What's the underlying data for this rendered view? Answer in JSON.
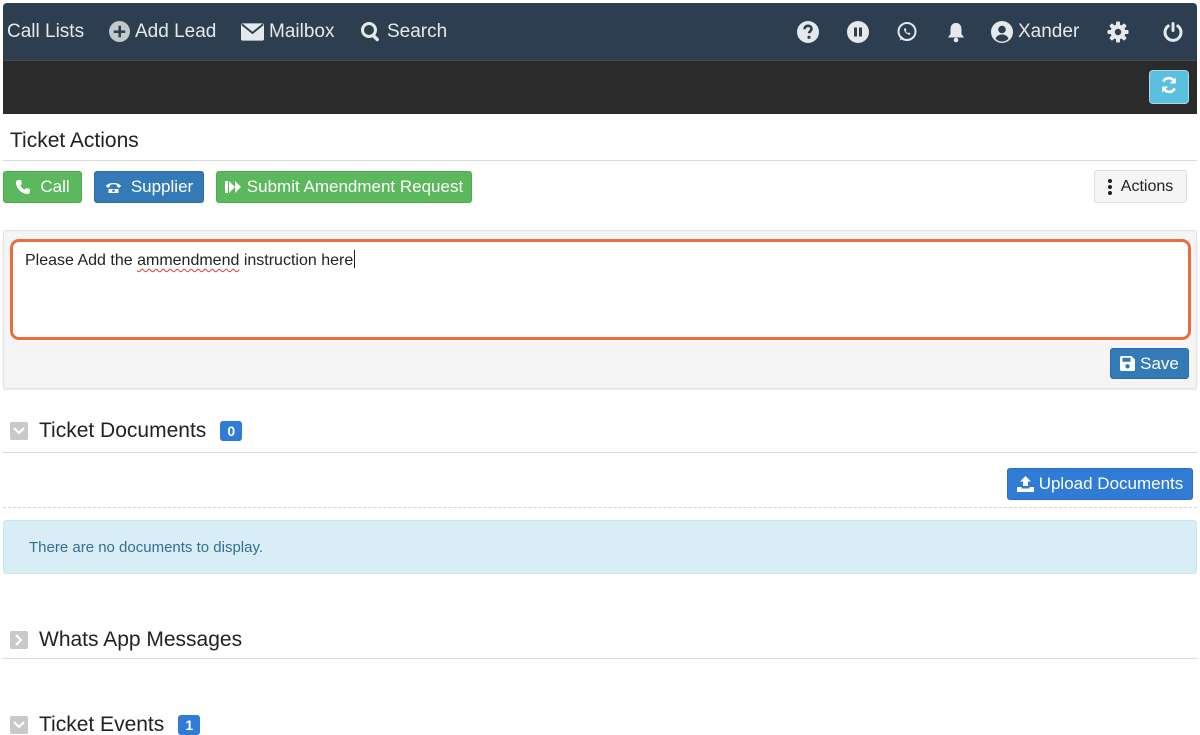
{
  "nav": {
    "call_lists": "Call Lists",
    "add_lead": "Add Lead",
    "mailbox": "Mailbox",
    "search": "Search",
    "user": "Xander"
  },
  "icons": {
    "add_lead": "plus-circle-icon",
    "mailbox": "envelope-icon",
    "search": "search-icon",
    "help": "question-circle-icon",
    "pause": "pause-circle-icon",
    "whatsapp": "whatsapp-icon",
    "notifications": "bell-icon",
    "user": "user-circle-icon",
    "settings": "gear-icon",
    "power": "power-icon",
    "refresh": "refresh-icon"
  },
  "ticket_actions": {
    "title": "Ticket Actions",
    "call_label": "Call",
    "supplier_label": "Supplier",
    "submit_label": "Submit Amendment Request",
    "actions_label": "Actions"
  },
  "amendment": {
    "text_before": "Please Add the ",
    "misspelled": "ammendmend",
    "text_after": " instruction here",
    "save_label": "Save"
  },
  "documents": {
    "title": "Ticket Documents",
    "count": "0",
    "upload_label": "Upload Documents",
    "empty_message": "There are no documents to display."
  },
  "whatsapp": {
    "title": "Whats App Messages"
  },
  "events": {
    "title": "Ticket Events",
    "count": "1"
  },
  "colors": {
    "nav_bg": "#2d3e50",
    "toolbar_bg": "#2b2b2b",
    "success": "#5cb85c",
    "primary": "#337ab7",
    "info": "#5bc0de",
    "focus_ring": "#ea6d3e",
    "badge": "#2f7bd6"
  }
}
